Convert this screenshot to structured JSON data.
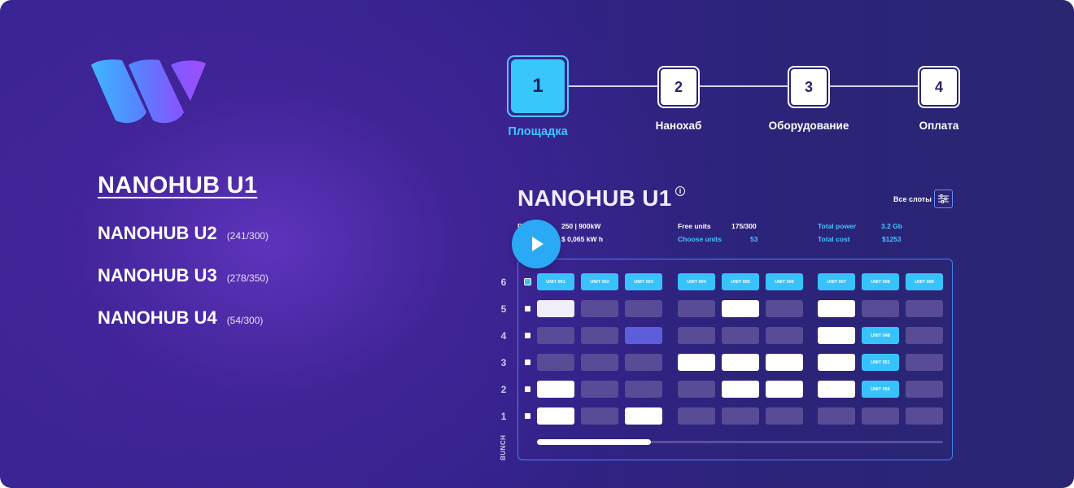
{
  "colors": {
    "accent_blue": "#37c2fb",
    "slot_empty": "#574c95",
    "slot_purple": "#5c5fd9",
    "step_text": "#2a2370"
  },
  "logo": {
    "icon": "w-logo"
  },
  "hubs": {
    "active": "NANOHUB U1",
    "items": [
      {
        "name": "NANOHUB U2",
        "count": "(241/300)"
      },
      {
        "name": "NANOHUB U3",
        "count": "(278/350)"
      },
      {
        "name": "NANOHUB U4",
        "count": "(54/300)"
      }
    ]
  },
  "steps": [
    {
      "number": "1",
      "label": "Площадка",
      "active": true
    },
    {
      "number": "2",
      "label": "Нанохаб",
      "active": false
    },
    {
      "number": "3",
      "label": "Оборудование",
      "active": false
    },
    {
      "number": "4",
      "label": "Оплата",
      "active": false
    }
  ],
  "panel": {
    "title": "NANOHUB U1",
    "info_icon": "i",
    "all_slots_label": "Все слоты",
    "filter_icon": "sliders-icon",
    "stats": {
      "partial_label": "R",
      "power_value": "250 | 900kW",
      "price_value": "$ 0,065 kW h",
      "free_units_label": "Free units",
      "free_units_value": "175/300",
      "choose_units_label": "Choose units",
      "choose_units_value": "53",
      "total_power_label": "Total power",
      "total_power_value": "3.2 Gb",
      "total_cost_label": "Total cost",
      "total_cost_value": "$1253"
    },
    "play_icon": "play-icon",
    "bunch_label": "BUNCH",
    "row_numbers": [
      "6",
      "5",
      "4",
      "3",
      "2",
      "1"
    ],
    "grid": [
      [
        "UNIT 001",
        "UNIT 002",
        "UNIT 003",
        "UNIT 004",
        "UNIT 005",
        "UNIT 006",
        "UNIT 007",
        "UNIT 008",
        "UNIT 009"
      ],
      [
        "light",
        "empty",
        "empty",
        "empty",
        "white",
        "empty",
        "white",
        "empty",
        "empty"
      ],
      [
        "empty",
        "empty",
        "purple",
        "empty",
        "empty",
        "empty",
        "white",
        "UNIT 048",
        "empty"
      ],
      [
        "empty",
        "empty",
        "empty",
        "white",
        "white",
        "white",
        "white",
        "UNIT 051",
        "empty"
      ],
      [
        "white",
        "empty",
        "empty",
        "empty",
        "white",
        "white",
        "white",
        "UNIT 056",
        "empty"
      ],
      [
        "white",
        "empty",
        "white",
        "empty",
        "empty",
        "empty",
        "empty",
        "empty",
        "empty"
      ]
    ],
    "scroll_position": 0.28
  }
}
